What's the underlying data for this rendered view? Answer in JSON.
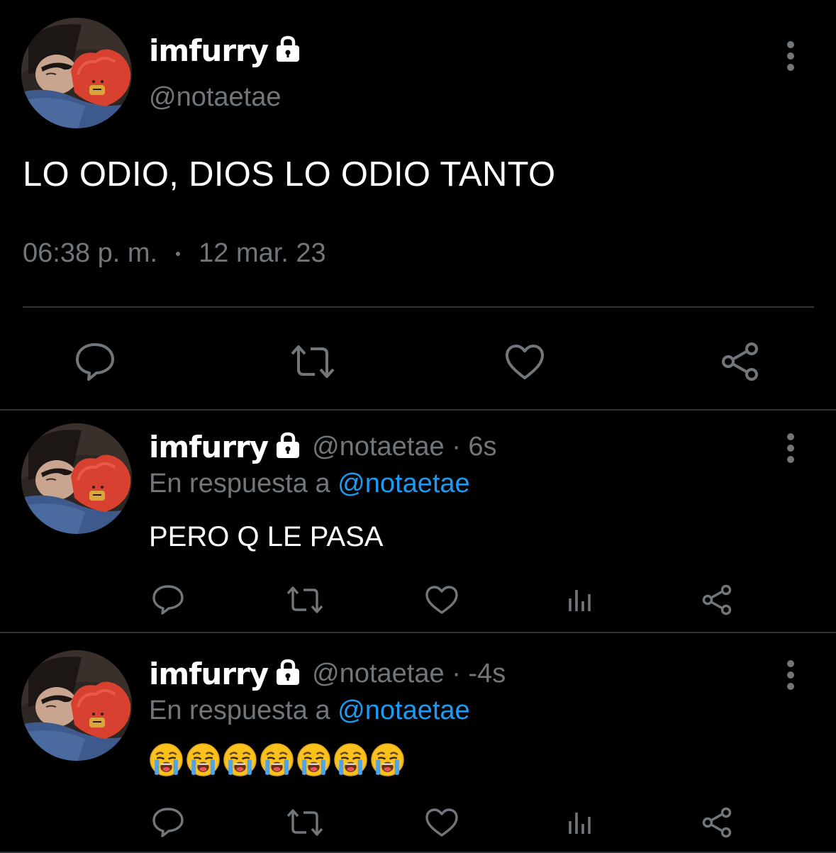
{
  "colors": {
    "background": "#000000",
    "text_primary": "#ffffff",
    "text_secondary": "#71767b",
    "accent": "#1d9bf0",
    "divider": "#2f3336"
  },
  "main_tweet": {
    "display_name": "imfurry",
    "handle": "@notaetae",
    "text": "LO ODIO, DIOS LO ODIO TANTO",
    "time": "06:38 p. m.",
    "date": "12 mar. 23",
    "actions": [
      "reply-icon",
      "retweet-icon",
      "like-icon",
      "share-icon"
    ]
  },
  "replies": [
    {
      "display_name": "imfurry",
      "handle_time": "@notaetae · 6s",
      "reply_to_prefix": "En respuesta a",
      "reply_to_handle": "@notaetae",
      "text": "PERO Q LE PASA",
      "actions": [
        "reply-icon",
        "retweet-icon",
        "like-icon",
        "analytics-icon",
        "share-icon"
      ]
    },
    {
      "display_name": "imfurry",
      "handle_time": "@notaetae · -4s",
      "reply_to_prefix": "En respuesta a",
      "reply_to_handle": "@notaetae",
      "emoji_name": "loudly-crying-face-emoji",
      "emoji_count": 7,
      "actions": [
        "reply-icon",
        "retweet-icon",
        "like-icon",
        "analytics-icon",
        "share-icon"
      ]
    }
  ]
}
